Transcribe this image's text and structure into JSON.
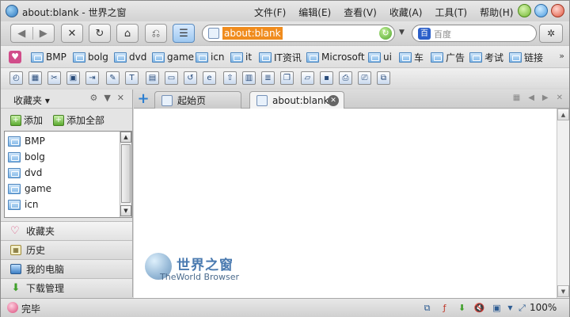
{
  "window": {
    "title": "about:blank - 世界之窗"
  },
  "menu": [
    {
      "label": "文件(F)"
    },
    {
      "label": "编辑(E)"
    },
    {
      "label": "查看(V)"
    },
    {
      "label": "收藏(A)"
    },
    {
      "label": "工具(T)"
    },
    {
      "label": "帮助(H)"
    }
  ],
  "nav": {
    "address": "about:blank",
    "search_placeholder": "百度",
    "search_icon_label": "百"
  },
  "bookmarks": [
    {
      "label": "BMP"
    },
    {
      "label": "bolg"
    },
    {
      "label": "dvd"
    },
    {
      "label": "game"
    },
    {
      "label": "icn"
    },
    {
      "label": "it"
    },
    {
      "label": "IT资讯"
    },
    {
      "label": "Microsoft"
    },
    {
      "label": "ui"
    },
    {
      "label": "车"
    },
    {
      "label": "广告"
    },
    {
      "label": "考试"
    },
    {
      "label": "链接"
    }
  ],
  "sidebar": {
    "title": "收藏夹",
    "add_label": "添加",
    "add_all_label": "添加全部",
    "items": [
      {
        "label": "BMP"
      },
      {
        "label": "bolg"
      },
      {
        "label": "dvd"
      },
      {
        "label": "game"
      },
      {
        "label": "icn"
      }
    ],
    "panels": [
      {
        "label": "收藏夹",
        "icon": "heart-icon"
      },
      {
        "label": "历史",
        "icon": "calendar-icon"
      },
      {
        "label": "我的电脑",
        "icon": "monitor-icon"
      },
      {
        "label": "下载管理",
        "icon": "download-arrow-icon"
      }
    ]
  },
  "tabs": [
    {
      "label": "起始页",
      "active": false
    },
    {
      "label": "about:blank",
      "active": true
    }
  ],
  "content": {
    "watermark_cn": "世界之窗",
    "watermark_en": "TheWorld Browser"
  },
  "status": {
    "text": "完毕",
    "zoom": "100%"
  },
  "colors": {
    "address_highlight": "#f08c1e",
    "accent_blue": "#2d7fd0"
  }
}
